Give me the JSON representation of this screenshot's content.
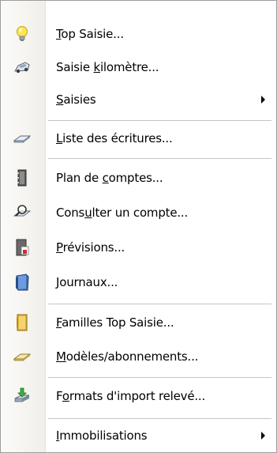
{
  "menu": {
    "items": [
      {
        "label_pre": "",
        "label_u": "T",
        "label_post": "op Saisie...",
        "icon": "lightbulb-icon",
        "submenu": false
      },
      {
        "label_pre": "Saisie ",
        "label_u": "k",
        "label_post": "ilomètre...",
        "icon": "car-icon",
        "submenu": false
      },
      {
        "label_pre": "",
        "label_u": "S",
        "label_post": "aisies",
        "icon": "",
        "submenu": true
      },
      {
        "label_pre": "",
        "label_u": "L",
        "label_post": "iste des écritures...",
        "icon": "open-book-icon",
        "submenu": false
      },
      {
        "label_pre": "Plan de ",
        "label_u": "c",
        "label_post": "omptes...",
        "icon": "notebook-icon",
        "submenu": false
      },
      {
        "label_pre": "Cons",
        "label_u": "u",
        "label_post": "lter un compte...",
        "icon": "magnify-book-icon",
        "submenu": false
      },
      {
        "label_pre": "",
        "label_u": "P",
        "label_post": "révisions...",
        "icon": "forecast-book-icon",
        "submenu": false
      },
      {
        "label_pre": "",
        "label_u": "J",
        "label_post": "ournaux...",
        "icon": "journal-book-icon",
        "submenu": false
      },
      {
        "label_pre": "",
        "label_u": "F",
        "label_post": "amilles Top Saisie...",
        "icon": "folder-book-icon",
        "submenu": false
      },
      {
        "label_pre": "",
        "label_u": "M",
        "label_post": "odèles/abonnements...",
        "icon": "template-book-icon",
        "submenu": false
      },
      {
        "label_pre": "F",
        "label_u": "o",
        "label_post": "rmats d'import relevé...",
        "icon": "import-arrow-icon",
        "submenu": false
      },
      {
        "label_pre": "",
        "label_u": "I",
        "label_post": "mmobilisations",
        "icon": "",
        "submenu": true
      }
    ]
  }
}
